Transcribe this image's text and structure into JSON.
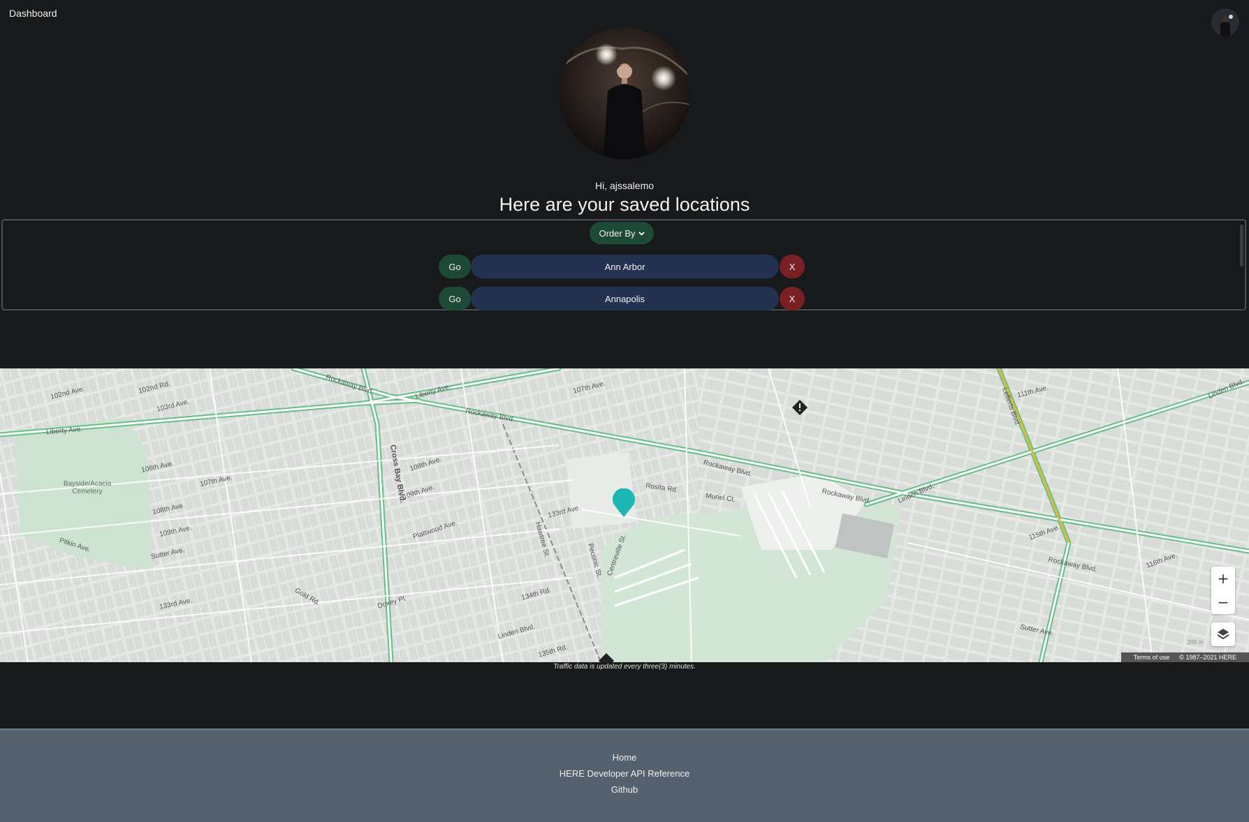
{
  "navbar": {
    "brand": "Dashboard"
  },
  "profile": {
    "greeting": "Hi, ajssalemo",
    "headline": "Here are your saved locations"
  },
  "locations": {
    "order_by_label": "Order By",
    "go_label": "Go",
    "delete_label": "X",
    "items": [
      {
        "name": "Ann Arbor"
      },
      {
        "name": "Annapolis"
      }
    ]
  },
  "map": {
    "street_labels": [
      "102nd Ave.",
      "102nd Rd.",
      "103rd Ave.",
      "Liberty Ave.",
      "Rockaway Blvd.",
      "Liberty Ave.",
      "107th Ave.",
      "Rockaway Blvd.",
      "Cross Bay Blvd.",
      "108th Ave.",
      "109th Ave.",
      "106th Ave.",
      "107th Ave.",
      "108th Ave.",
      "109th Ave.",
      "Sutter Ave.",
      "Pitkin Ave.",
      "133rd Ave.",
      "Plattwood Ave.",
      "133rd Ave.",
      "Rosita Rd.",
      "Muriel Ct.",
      "Rockaway Blvd.",
      "Rockaway Blvd.",
      "Linden Blvd.",
      "111th Ave.",
      "Linden Blvd.",
      "115th Ave.",
      "Rockaway Blvd.",
      "116th Ave.",
      "Sutter Ave.",
      "Linden Blvd.",
      "135th Rd.",
      "134th Rd.",
      "Gold Rd.",
      "Doxey Pl.",
      "Lefferts Blvd.",
      "Centreville St.",
      "Hawtree St.",
      "Peconic St."
    ],
    "park_label": "Bayside/Acacia Cemetery",
    "zoom_in": "+",
    "zoom_out": "−",
    "terms_label": "Terms of use",
    "copyright": "© 1987–2021 HERE",
    "scale_label": "200 m"
  },
  "traffic_note": "Traffic data is updated every three(3) minutes.",
  "footer": {
    "links": [
      "Home",
      "HERE Developer API Reference",
      "Github"
    ]
  },
  "colors": {
    "background": "#18191b",
    "go_button": "#1d4a37",
    "location_button": "#223250",
    "delete_button": "#7a2024",
    "footer": "#55606f",
    "pin": "#1bb7b5",
    "road_highlight": "#5cbf7f"
  }
}
